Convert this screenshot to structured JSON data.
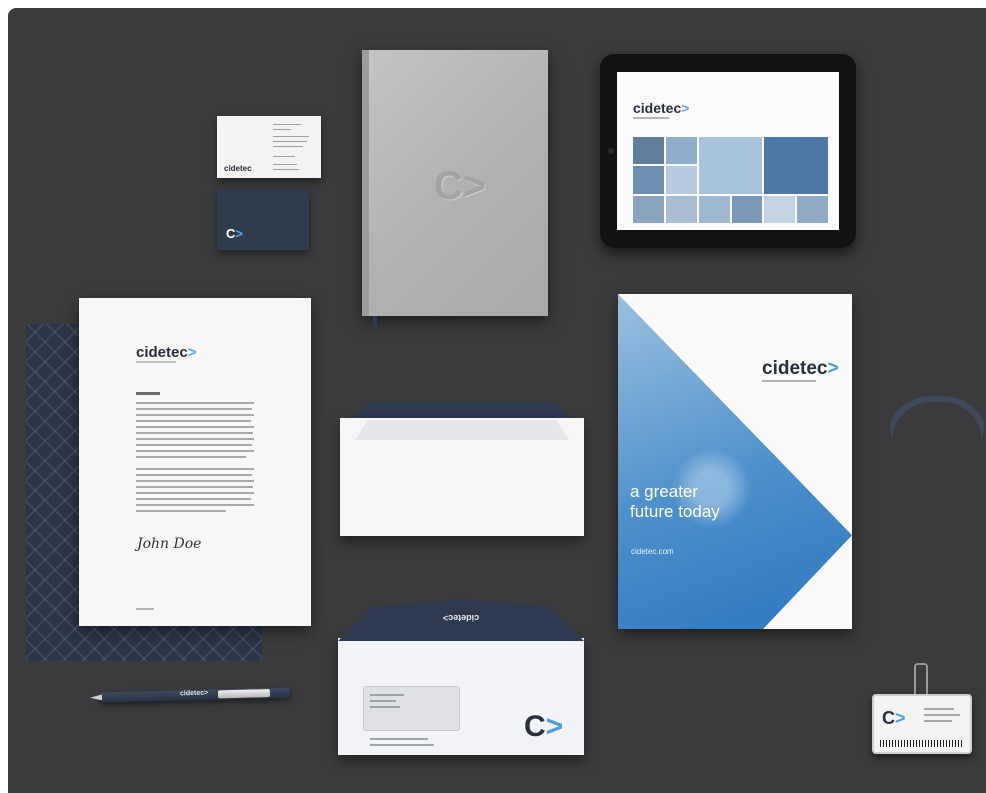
{
  "brand": {
    "wordmark": "cidetec",
    "wordmark_upside": "cidetec>",
    "mark_c": "C",
    "mark_arrow": ">",
    "arrow_suffix": ">",
    "colors": {
      "background": "#3b3b3d",
      "navy": "#2e3a4f",
      "accent_blue": "#4d9be0",
      "paper": "#f7f7f5"
    }
  },
  "business_card": {
    "logo": "cidetec"
  },
  "letterhead": {
    "signature": "John Doe"
  },
  "brochure": {
    "logo": "cidetec",
    "tagline_line1": "a greater",
    "tagline_line2": "future today",
    "url": "cidetec.com"
  },
  "pen": {
    "label": "cidetec>"
  },
  "badge": {
    "logo": "C"
  }
}
